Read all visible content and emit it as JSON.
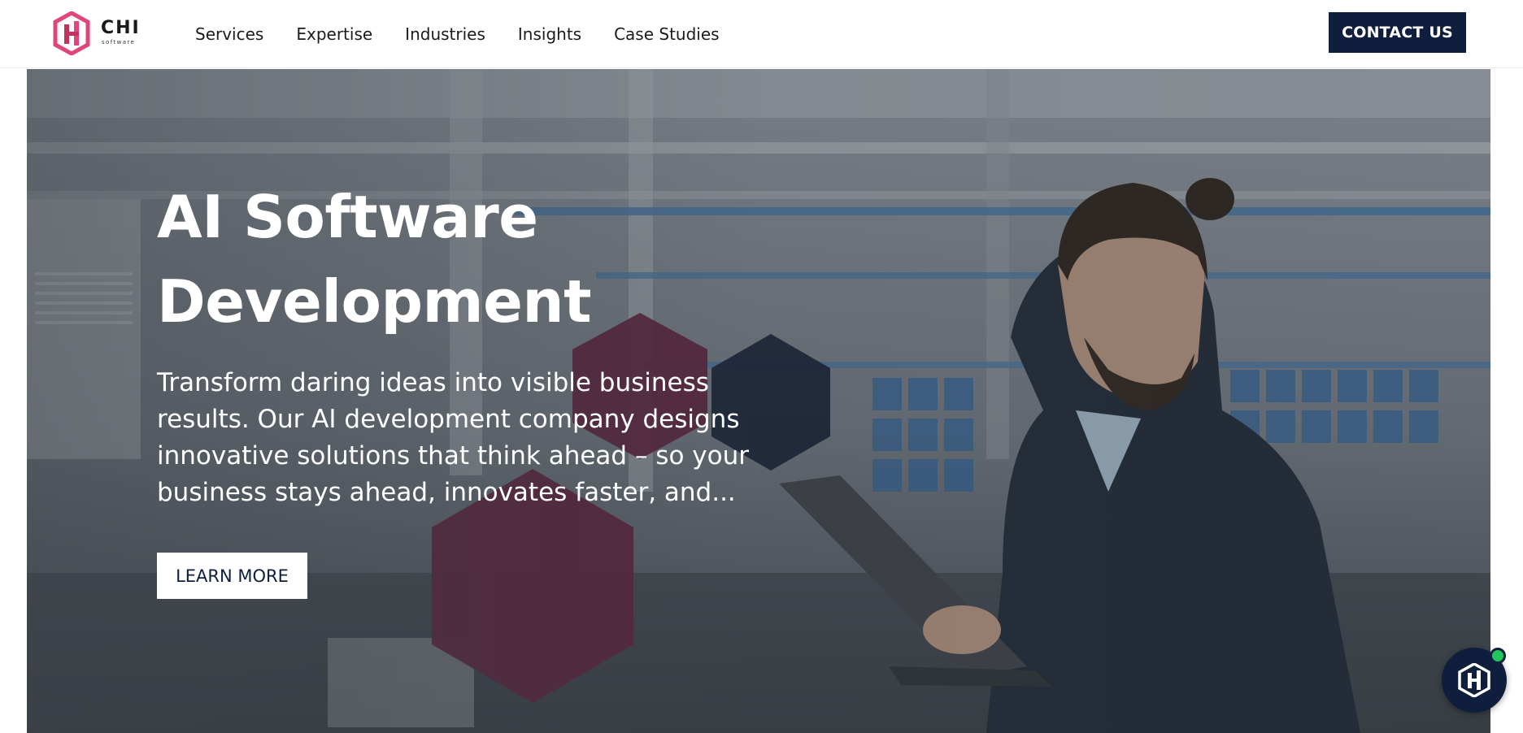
{
  "brand": {
    "name": "CHI",
    "tagline": "software",
    "accent_color": "#e0457b",
    "primary_color": "#0f1e3c",
    "hex_color": "#5b1f3a"
  },
  "nav": {
    "items": [
      {
        "label": "Services"
      },
      {
        "label": "Expertise"
      },
      {
        "label": "Industries"
      },
      {
        "label": "Insights"
      },
      {
        "label": "Case Studies"
      }
    ]
  },
  "header": {
    "contact_label": "CONTACT US"
  },
  "hero": {
    "title_line1": "AI Software",
    "title_line2": "Development",
    "description_lines": [
      "Transform daring ideas into visible business",
      "results. Our AI development company designs",
      "innovative solutions that think ahead – so your",
      "business stays ahead, innovates faster, and..."
    ],
    "cta_label": "LEARN MORE"
  },
  "chat": {
    "icon": "chi-logo-icon",
    "status_color": "#22c55e"
  }
}
